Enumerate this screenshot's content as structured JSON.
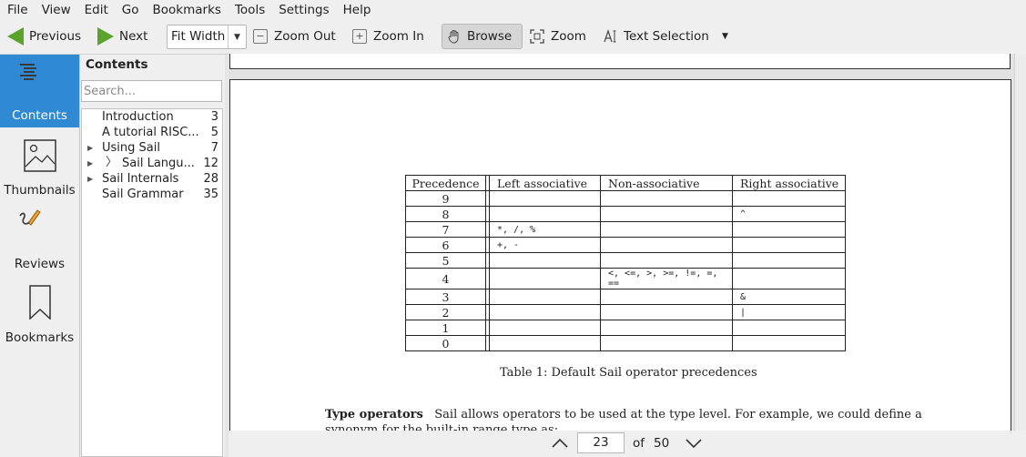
{
  "menu": [
    "File",
    "View",
    "Edit",
    "Go",
    "Bookmarks",
    "Tools",
    "Settings",
    "Help"
  ],
  "toolbar": {
    "previous": "Previous",
    "next": "Next",
    "zoom_value": "Fit Width",
    "zoom_out": "Zoom Out",
    "zoom_in": "Zoom In",
    "browse": "Browse",
    "zoom": "Zoom",
    "text_selection": "Text Selection"
  },
  "sidebar": {
    "contents": "Contents",
    "thumbnails": "Thumbnails",
    "reviews": "Reviews",
    "bookmarks": "Bookmarks"
  },
  "contents_panel": {
    "title": "Contents",
    "search_placeholder": "Search...",
    "items": [
      {
        "label": "Introduction",
        "page": "3",
        "expandable": false
      },
      {
        "label": "A tutorial RISC...",
        "page": "5",
        "expandable": false
      },
      {
        "label": "Using Sail",
        "page": "7",
        "expandable": true
      },
      {
        "label": "Sail Langu...",
        "page": "12",
        "expandable": true
      },
      {
        "label": "Sail Internals",
        "page": "28",
        "expandable": true
      },
      {
        "label": "Sail Grammar",
        "page": "35",
        "expandable": false
      }
    ]
  },
  "document": {
    "table_headers": [
      "Precedence",
      "Left associative",
      "Non-associative",
      "Right associative"
    ],
    "table_rows": [
      [
        "9",
        "",
        "",
        ""
      ],
      [
        "8",
        "",
        "",
        "^"
      ],
      [
        "7",
        "*, /, %",
        "",
        ""
      ],
      [
        "6",
        "+, -",
        "",
        ""
      ],
      [
        "5",
        "",
        "",
        ""
      ],
      [
        "4",
        "",
        "<, <=, >, >=, !=, =, ==",
        ""
      ],
      [
        "3",
        "",
        "",
        "&"
      ],
      [
        "2",
        "",
        "",
        "|"
      ],
      [
        "1",
        "",
        "",
        ""
      ],
      [
        "0",
        "",
        "",
        ""
      ]
    ],
    "caption": "Table 1: Default Sail operator precedences",
    "para_heading": "Type operators",
    "para_text": "Sail allows operators to be used at the type level. For example, we could define a synonym for the built-in range type as:"
  },
  "navigation": {
    "current_page": "23",
    "of_label": "of",
    "total_pages": "50"
  },
  "colors": {
    "accent": "#2f8ad3",
    "arrow_green": "#5aa32a"
  }
}
